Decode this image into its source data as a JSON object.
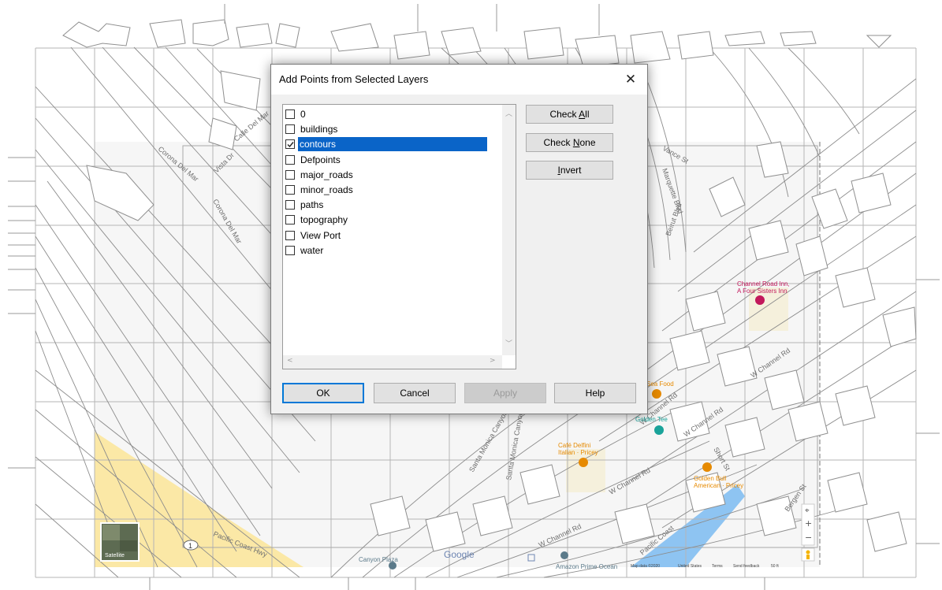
{
  "dialog": {
    "title": "Add Points from Selected Layers",
    "close_glyph": "✕",
    "layers": [
      {
        "name": "0",
        "checked": false
      },
      {
        "name": "buildings",
        "checked": false
      },
      {
        "name": "contours",
        "checked": true,
        "selected": true
      },
      {
        "name": "Defpoints",
        "checked": false
      },
      {
        "name": "major_roads",
        "checked": false
      },
      {
        "name": "minor_roads",
        "checked": false
      },
      {
        "name": "paths",
        "checked": false
      },
      {
        "name": "topography",
        "checked": false
      },
      {
        "name": "View Port",
        "checked": false
      },
      {
        "name": "water",
        "checked": false
      }
    ],
    "check_all": {
      "pre": "Check ",
      "key": "A",
      "post": "ll"
    },
    "check_none": {
      "pre": "Check ",
      "key": "N",
      "post": "one"
    },
    "invert": {
      "pre": "",
      "key": "I",
      "post": "nvert"
    },
    "ok": "OK",
    "cancel": "Cancel",
    "apply": "Apply",
    "help": "Help",
    "selection_color": "#0a64c8"
  },
  "map": {
    "street_labels": [
      "Corona Del Mar",
      "Corona Del Mar",
      "Vista Dr",
      "Calle Del Mar",
      "Vance St",
      "Marquette Blvd",
      "Beirut Blvd",
      "W Channel Rd",
      "W Channel Rd",
      "W Channel Rd",
      "W Channel Rd",
      "W Channel Rd",
      "Pacific Coast Hwy",
      "Santa Monica Canyon",
      "Santa Monica Canyon Rd",
      "Pacific Coast",
      "Bergen St",
      "Short St"
    ],
    "pois": [
      {
        "name": "Channel Road Inn,",
        "sub": "A Four Sisters Inn",
        "color": "#c2185b",
        "icon": "bed-pin-icon"
      },
      {
        "name": "Café Delfini",
        "sub": "Italian · Pricey",
        "color": "#e68a00",
        "icon": "restaurant-pin-icon"
      },
      {
        "name": "Golden Bull",
        "sub": "American · Pricey",
        "color": "#e68a00",
        "icon": "restaurant-pin-icon"
      },
      {
        "name": "Golden Tee",
        "sub": "",
        "color": "#1aa39a",
        "icon": "store-pin-icon"
      },
      {
        "name": "Sea Food",
        "sub": "",
        "color": "#e68a00",
        "icon": "restaurant-pin-icon"
      },
      {
        "name": "Amazon Prime Ocean",
        "sub": "",
        "color": "#5b7a8a",
        "icon": "place-pin-icon"
      },
      {
        "name": "Canyon Plaza",
        "sub": "",
        "color": "#5b7a8a",
        "icon": "place-pin-icon"
      }
    ],
    "satellite_label": "Satellite",
    "google_logo": "Google",
    "attribution": [
      "Map data ©2020",
      "United States",
      "Terms",
      "Send feedback",
      "50 ft"
    ],
    "route_shield": "1",
    "zoom_in": "+",
    "zoom_out": "−",
    "colors": {
      "beach": "#fbe8a6",
      "water": "#8ec4f2",
      "building": "#f6f6f6",
      "lines": "#9a9a9a",
      "grid": "#b0b0b0"
    }
  }
}
